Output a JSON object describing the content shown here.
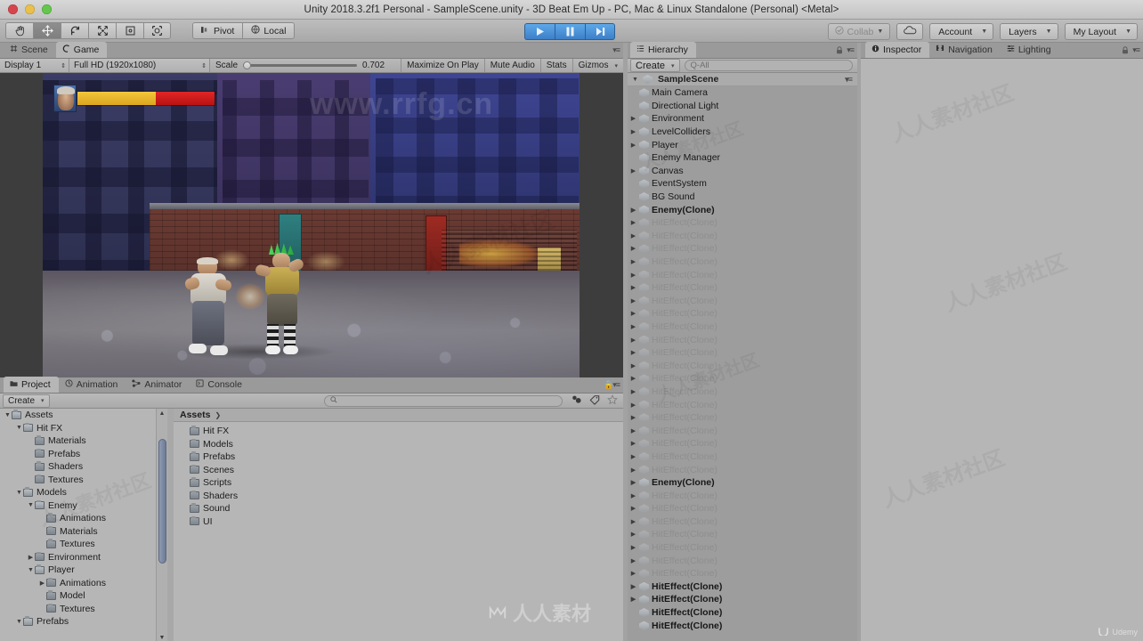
{
  "window": {
    "title": "Unity 2018.3.2f1 Personal - SampleScene.unity - 3D Beat Em Up - PC, Mac & Linux Standalone (Personal) <Metal>"
  },
  "toolbar": {
    "tools": [
      {
        "name": "hand-tool",
        "icon": "hand-icon",
        "active": false
      },
      {
        "name": "move-tool",
        "icon": "move-icon",
        "active": true
      },
      {
        "name": "rotate-tool",
        "icon": "rotate-icon",
        "active": false
      },
      {
        "name": "scale-tool",
        "icon": "scale-icon",
        "active": false
      },
      {
        "name": "rect-tool",
        "icon": "rect-transform-icon",
        "active": false
      },
      {
        "name": "transform-tool",
        "icon": "transform-icon",
        "active": false
      }
    ],
    "pivot_label": "Pivot",
    "local_label": "Local",
    "play_label": "play-button",
    "pause_label": "pause-button",
    "step_label": "step-button",
    "collab_label": "Collab",
    "cloud_label": "cloud-icon",
    "account_label": "Account",
    "layers_label": "Layers",
    "layout_label": "My Layout"
  },
  "game_view": {
    "tabs": [
      {
        "label": "Scene",
        "icon": "scene-icon",
        "selected": false
      },
      {
        "label": "Game",
        "icon": "game-icon",
        "selected": true
      }
    ],
    "display": "Display 1",
    "resolution": "Full HD (1920x1080)",
    "scale_label": "Scale",
    "scale_value": "0.702",
    "maximize_on_play": "Maximize On Play",
    "mute_audio": "Mute Audio",
    "stats": "Stats",
    "gizmos": "Gizmos",
    "hud": {
      "health_yellow_pct": 57,
      "health_red_pct": 43
    }
  },
  "project": {
    "tabs": [
      {
        "label": "Project",
        "icon": "project-icon",
        "selected": true
      },
      {
        "label": "Animation",
        "icon": "animation-icon",
        "selected": false
      },
      {
        "label": "Animator",
        "icon": "animator-icon",
        "selected": false
      },
      {
        "label": "Console",
        "icon": "console-icon",
        "selected": false
      }
    ],
    "create_label": "Create",
    "search_placeholder": "",
    "breadcrumb": "Assets",
    "tree": [
      {
        "label": "Assets",
        "depth": 0,
        "tri": "down",
        "open": true
      },
      {
        "label": "Hit FX",
        "depth": 1,
        "tri": "down",
        "open": true
      },
      {
        "label": "Materials",
        "depth": 2,
        "tri": "none",
        "open": false
      },
      {
        "label": "Prefabs",
        "depth": 2,
        "tri": "none",
        "open": false
      },
      {
        "label": "Shaders",
        "depth": 2,
        "tri": "none",
        "open": false
      },
      {
        "label": "Textures",
        "depth": 2,
        "tri": "none",
        "open": false
      },
      {
        "label": "Models",
        "depth": 1,
        "tri": "down",
        "open": true
      },
      {
        "label": "Enemy",
        "depth": 2,
        "tri": "down",
        "open": true
      },
      {
        "label": "Animations",
        "depth": 3,
        "tri": "none",
        "open": false
      },
      {
        "label": "Materials",
        "depth": 3,
        "tri": "none",
        "open": false
      },
      {
        "label": "Textures",
        "depth": 3,
        "tri": "none",
        "open": false
      },
      {
        "label": "Environment",
        "depth": 2,
        "tri": "right",
        "open": false
      },
      {
        "label": "Player",
        "depth": 2,
        "tri": "down",
        "open": true
      },
      {
        "label": "Animations",
        "depth": 3,
        "tri": "right",
        "open": false
      },
      {
        "label": "Model",
        "depth": 3,
        "tri": "none",
        "open": false
      },
      {
        "label": "Textures",
        "depth": 3,
        "tri": "none",
        "open": false
      },
      {
        "label": "Prefabs",
        "depth": 1,
        "tri": "down",
        "open": true
      }
    ],
    "folders": [
      "Hit FX",
      "Models",
      "Prefabs",
      "Scenes",
      "Scripts",
      "Shaders",
      "Sound",
      "UI"
    ]
  },
  "hierarchy": {
    "tab_label": "Hierarchy",
    "create_label": "Create",
    "search_placeholder": "Q-All",
    "scene_name": "SampleScene",
    "items": [
      {
        "label": "Main Camera",
        "tri": false,
        "state": "normal"
      },
      {
        "label": "Directional Light",
        "tri": false,
        "state": "normal"
      },
      {
        "label": "Environment",
        "tri": true,
        "state": "normal"
      },
      {
        "label": "LevelColliders",
        "tri": true,
        "state": "normal"
      },
      {
        "label": "Player",
        "tri": true,
        "state": "normal"
      },
      {
        "label": "Enemy Manager",
        "tri": false,
        "state": "normal"
      },
      {
        "label": "Canvas",
        "tri": true,
        "state": "normal"
      },
      {
        "label": "EventSystem",
        "tri": false,
        "state": "normal"
      },
      {
        "label": "BG Sound",
        "tri": false,
        "state": "normal"
      },
      {
        "label": "Enemy(Clone)",
        "tri": true,
        "state": "bold"
      },
      {
        "label": "HitEffect(Clone)",
        "tri": true,
        "state": "dim"
      },
      {
        "label": "HitEffect(Clone)",
        "tri": true,
        "state": "dim"
      },
      {
        "label": "HitEffect(Clone)",
        "tri": true,
        "state": "dim"
      },
      {
        "label": "HitEffect(Clone)",
        "tri": true,
        "state": "dim"
      },
      {
        "label": "HitEffect(Clone)",
        "tri": true,
        "state": "dim"
      },
      {
        "label": "HitEffect(Clone)",
        "tri": true,
        "state": "dim"
      },
      {
        "label": "HitEffect(Clone)",
        "tri": true,
        "state": "dim"
      },
      {
        "label": "HitEffect(Clone)",
        "tri": true,
        "state": "dim"
      },
      {
        "label": "HitEffect(Clone)",
        "tri": true,
        "state": "dim"
      },
      {
        "label": "HitEffect(Clone)",
        "tri": true,
        "state": "dim"
      },
      {
        "label": "HitEffect(Clone)",
        "tri": true,
        "state": "dim"
      },
      {
        "label": "HitEffect(Clone)",
        "tri": true,
        "state": "dim"
      },
      {
        "label": "HitEffect(Clone)",
        "tri": true,
        "state": "dim"
      },
      {
        "label": "HitEffect(Clone)",
        "tri": true,
        "state": "dim"
      },
      {
        "label": "HitEffect(Clone)",
        "tri": true,
        "state": "dim"
      },
      {
        "label": "HitEffect(Clone)",
        "tri": true,
        "state": "dim"
      },
      {
        "label": "HitEffect(Clone)",
        "tri": true,
        "state": "dim"
      },
      {
        "label": "HitEffect(Clone)",
        "tri": true,
        "state": "dim"
      },
      {
        "label": "HitEffect(Clone)",
        "tri": true,
        "state": "dim"
      },
      {
        "label": "HitEffect(Clone)",
        "tri": true,
        "state": "dim"
      },
      {
        "label": "Enemy(Clone)",
        "tri": true,
        "state": "bold"
      },
      {
        "label": "HitEffect(Clone)",
        "tri": true,
        "state": "dim"
      },
      {
        "label": "HitEffect(Clone)",
        "tri": true,
        "state": "dim"
      },
      {
        "label": "HitEffect(Clone)",
        "tri": true,
        "state": "dim"
      },
      {
        "label": "HitEffect(Clone)",
        "tri": true,
        "state": "dim"
      },
      {
        "label": "HitEffect(Clone)",
        "tri": true,
        "state": "dim"
      },
      {
        "label": "HitEffect(Clone)",
        "tri": true,
        "state": "dim"
      },
      {
        "label": "HitEffect(Clone)",
        "tri": true,
        "state": "dim"
      },
      {
        "label": "HitEffect(Clone)",
        "tri": true,
        "state": "bold"
      },
      {
        "label": "HitEffect(Clone)",
        "tri": true,
        "state": "bold"
      },
      {
        "label": "HitEffect(Clone)",
        "tri": false,
        "state": "bold"
      },
      {
        "label": "HitEffect(Clone)",
        "tri": false,
        "state": "bold"
      }
    ]
  },
  "inspector": {
    "tabs": [
      {
        "label": "Inspector",
        "icon": "inspector-icon",
        "selected": true
      },
      {
        "label": "Navigation",
        "icon": "navigation-icon",
        "selected": false
      },
      {
        "label": "Lighting",
        "icon": "lighting-icon",
        "selected": false
      }
    ]
  },
  "watermarks": {
    "url": "www.rrfg.cn",
    "cn": "人人素材社区",
    "brand": "人人素材",
    "udemy": "Udemy"
  },
  "colors": {
    "panel_bg": "#b6b6b6",
    "chrome": "#a2a2a2",
    "play_active": "#3c7fc8",
    "health_yellow": "#dca520",
    "health_red": "#c41818"
  }
}
